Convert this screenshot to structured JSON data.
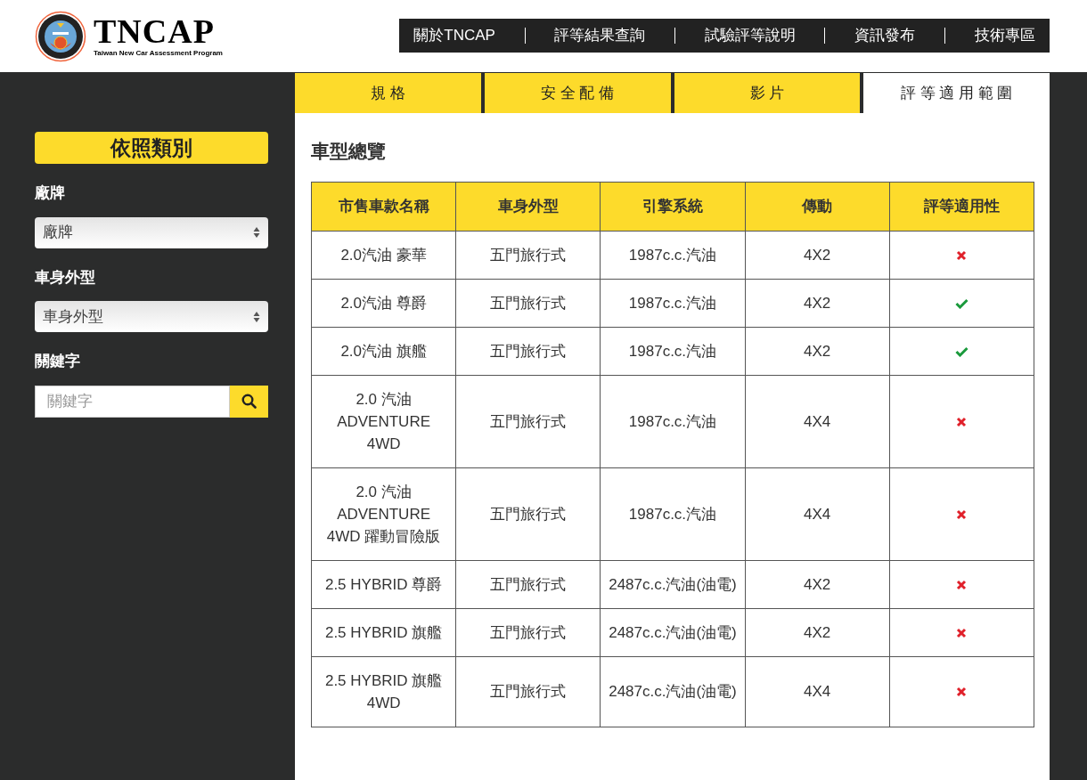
{
  "logo": {
    "wordmark": "TNCAP",
    "tagline": "Taiwan New Car Assessment Program"
  },
  "nav": [
    "關於TNCAP",
    "評等結果查詢",
    "試驗評等說明",
    "資訊發布",
    "技術專區"
  ],
  "sidebar": {
    "title": "依照類別",
    "filters": [
      {
        "kind": "select",
        "label": "廠牌",
        "value": "廠牌"
      },
      {
        "kind": "select",
        "label": "車身外型",
        "value": "車身外型"
      },
      {
        "kind": "search",
        "label": "關鍵字",
        "placeholder": "關鍵字"
      }
    ]
  },
  "tabs": [
    {
      "label": "規 格",
      "selected": false
    },
    {
      "label": "安 全 配 備",
      "selected": false
    },
    {
      "label": "影 片",
      "selected": false
    },
    {
      "label": "評 等 適 用 範 圍",
      "selected": true
    }
  ],
  "section_title": "車型總覽",
  "table": {
    "columns": [
      "市售車款名稱",
      "車身外型",
      "引擎系統",
      "傳動",
      "評等適用性"
    ],
    "rows": [
      {
        "name": "2.0汽油 豪華",
        "body": "五門旅行式",
        "engine": "1987c.c.汽油",
        "drive": "4X2",
        "applicable": false
      },
      {
        "name": "2.0汽油 尊爵",
        "body": "五門旅行式",
        "engine": "1987c.c.汽油",
        "drive": "4X2",
        "applicable": true
      },
      {
        "name": "2.0汽油 旗艦",
        "body": "五門旅行式",
        "engine": "1987c.c.汽油",
        "drive": "4X2",
        "applicable": true
      },
      {
        "name": "2.0 汽油 ADVENTURE 4WD",
        "body": "五門旅行式",
        "engine": "1987c.c.汽油",
        "drive": "4X4",
        "applicable": false
      },
      {
        "name": "2.0 汽油 ADVENTURE 4WD 躍動冒險版",
        "body": "五門旅行式",
        "engine": "1987c.c.汽油",
        "drive": "4X4",
        "applicable": false
      },
      {
        "name": "2.5 HYBRID 尊爵",
        "body": "五門旅行式",
        "engine": "2487c.c.汽油(油電)",
        "drive": "4X2",
        "applicable": false
      },
      {
        "name": "2.5 HYBRID 旗艦",
        "body": "五門旅行式",
        "engine": "2487c.c.汽油(油電)",
        "drive": "4X2",
        "applicable": false
      },
      {
        "name": "2.5 HYBRID 旗艦 4WD",
        "body": "五門旅行式",
        "engine": "2487c.c.汽油(油電)",
        "drive": "4X4",
        "applicable": false
      }
    ]
  }
}
